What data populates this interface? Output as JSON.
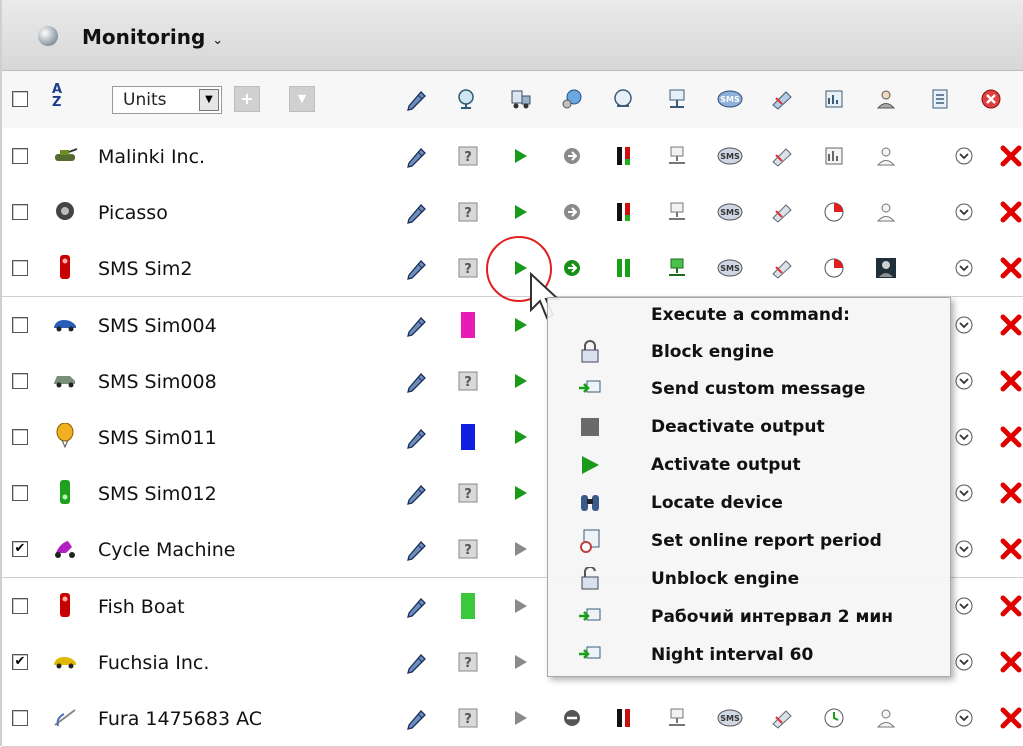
{
  "header": {
    "title": "Monitoring",
    "caret": "⌄"
  },
  "toolbar": {
    "sort_top": "A",
    "sort_bottom": "Z",
    "units_select_value": "Units",
    "column_icons": [
      "edit-icon",
      "status-icon",
      "commands-icon",
      "gps-icon",
      "dispatch-icon",
      "gsm-icon",
      "sms-icon",
      "sensor-icon",
      "report-icon",
      "driver-icon",
      "info-icon",
      "delete-icon"
    ]
  },
  "rows": [
    {
      "name": "Malinki Inc.",
      "checked": false,
      "icon": "tank-icon",
      "status": "unknown",
      "active": true
    },
    {
      "name": "Picasso",
      "checked": false,
      "icon": "wheel-icon",
      "status": "unknown",
      "active": true
    },
    {
      "name": "SMS Sim2",
      "checked": false,
      "icon": "traffic-light-icon",
      "status": "unknown",
      "active": true
    },
    {
      "name": "SMS Sim004",
      "checked": false,
      "icon": "car-icon",
      "status": "magenta",
      "active": true
    },
    {
      "name": "SMS Sim008",
      "checked": false,
      "icon": "jeep-icon",
      "status": "unknown",
      "active": true
    },
    {
      "name": "SMS Sim011",
      "checked": false,
      "icon": "balloon-icon",
      "status": "blue",
      "active": true
    },
    {
      "name": "SMS Sim012",
      "checked": false,
      "icon": "traffic-light-green-icon",
      "status": "unknown",
      "active": true
    },
    {
      "name": "Cycle Machine",
      "checked": true,
      "icon": "scooter-icon",
      "status": "unknown",
      "active": false
    },
    {
      "name": "Fish Boat",
      "checked": false,
      "icon": "traffic-light-icon",
      "status": "green",
      "active": false
    },
    {
      "name": "Fuchsia Inc.",
      "checked": true,
      "icon": "taxi-icon",
      "status": "unknown",
      "active": false
    },
    {
      "name": "Fura 1475683 AC",
      "checked": false,
      "icon": "satellite-icon",
      "status": "unknown",
      "active": false
    }
  ],
  "menu": {
    "title": "Execute a command:",
    "items": [
      {
        "label": "Block engine",
        "icon": "lock-icon"
      },
      {
        "label": "Send custom message",
        "icon": "message-icon"
      },
      {
        "label": "Deactivate output",
        "icon": "stop-icon"
      },
      {
        "label": "Activate output",
        "icon": "play-icon"
      },
      {
        "label": "Locate device",
        "icon": "binoculars-icon"
      },
      {
        "label": "Set online report period",
        "icon": "report-period-icon"
      },
      {
        "label": "Unblock engine",
        "icon": "unlock-icon"
      },
      {
        "label": "Рабочий интервал 2 мин",
        "icon": "message-icon"
      },
      {
        "label": "Night interval 60",
        "icon": "message-icon"
      }
    ]
  },
  "colors": {
    "magenta": "#e81cb4",
    "blue": "#1020e0",
    "green": "#3cc83c",
    "delete": "#e00000",
    "play": "#1a9a1a"
  }
}
